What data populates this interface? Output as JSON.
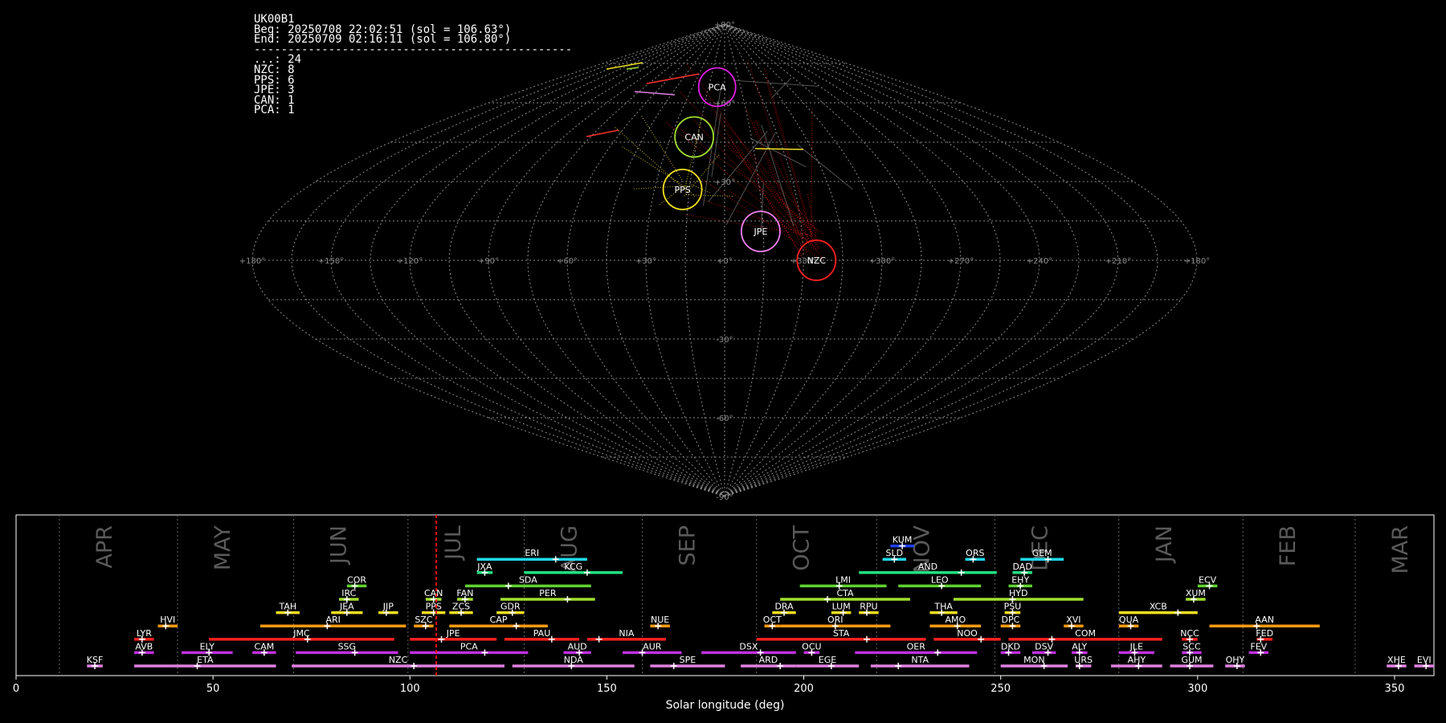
{
  "header": {
    "station": "UK00B1",
    "begin": "Beg: 20250708 22:02:51 (sol = 106.63°)",
    "end": "End: 20250709 02:16:11 (sol = 106.80°)",
    "separator": "-----------------------------------------------",
    "counts": [
      "...: 24",
      "NZC: 8",
      "PPS: 6",
      "JPE: 3",
      "CAN: 1",
      "PCA: 1"
    ]
  },
  "chart_data": [
    {
      "type": "scatter",
      "projection": "sinusoidal",
      "grid": true,
      "lon_labels": [
        "+180°",
        "+150°",
        "+120°",
        "+90°",
        "+60°",
        "+30°",
        "+0°",
        "+330°",
        "+300°",
        "+270°",
        "+240°",
        "+210°",
        "+180°"
      ],
      "lat_labels": [
        {
          "lat": 90,
          "text": "+90°"
        },
        {
          "lat": 60,
          "text": "+60°"
        },
        {
          "lat": 30,
          "text": "+30°"
        },
        {
          "lat": -30,
          "text": "-30°"
        },
        {
          "lat": -60,
          "text": "-60°"
        },
        {
          "lat": -90,
          "text": "-90°"
        }
      ],
      "radiants": [
        {
          "name": "PCA",
          "lon": 7,
          "lat": 66,
          "r": 23,
          "color": "#e020e0"
        },
        {
          "name": "CAN",
          "lon": 17,
          "lat": 47,
          "r": 24,
          "color": "#a0e030"
        },
        {
          "name": "PPS",
          "lon": 18,
          "lat": 27,
          "r": 24,
          "color": "#f0e020"
        },
        {
          "name": "JPE",
          "lon": 346,
          "lat": 11,
          "r": 24,
          "color": "#f080f0"
        },
        {
          "name": "NZC",
          "lon": 325,
          "lat": 0,
          "r": 24,
          "color": "#ff2020"
        }
      ]
    },
    {
      "type": "bar",
      "xlabel": "Solar longitude (deg)",
      "xlim": [
        0,
        360
      ],
      "ylim": [
        0,
        13.5
      ],
      "xticks": [
        0,
        50,
        100,
        150,
        200,
        250,
        300,
        350
      ],
      "current_sol": 106.7,
      "months": [
        {
          "name": "APR",
          "start": 11
        },
        {
          "name": "MAY",
          "start": 41
        },
        {
          "name": "JUN",
          "start": 70.5
        },
        {
          "name": "JUL",
          "start": 99.5
        },
        {
          "name": "AUG",
          "start": 129
        },
        {
          "name": "SEP",
          "start": 159
        },
        {
          "name": "OCT",
          "start": 188
        },
        {
          "name": "NOV",
          "start": 218.5
        },
        {
          "name": "DEC",
          "start": 248.5
        },
        {
          "name": "JAN",
          "start": 280
        },
        {
          "name": "FEB",
          "start": 311.5
        },
        {
          "name": "MAR",
          "start": 340
        }
      ],
      "showers": [
        {
          "code": "KSF",
          "start": 18,
          "end": 22,
          "peak": 20,
          "row": 0,
          "color": "#e080e0"
        },
        {
          "code": "ETA",
          "start": 30,
          "end": 66,
          "peak": 46,
          "row": 0,
          "color": "#e080e0"
        },
        {
          "code": "NZC",
          "start": 70,
          "end": 124,
          "peak": 101,
          "row": 0,
          "color": "#e080e0"
        },
        {
          "code": "NDA",
          "start": 126,
          "end": 157,
          "peak": 141,
          "row": 0,
          "color": "#e080e0"
        },
        {
          "code": "SPE",
          "start": 161,
          "end": 180,
          "peak": 167,
          "row": 0,
          "color": "#e080e0"
        },
        {
          "code": "ARD",
          "start": 184,
          "end": 198,
          "peak": 194,
          "row": 0,
          "color": "#e080e0"
        },
        {
          "code": "EGE",
          "start": 198,
          "end": 214,
          "peak": 207,
          "row": 0,
          "color": "#e080e0"
        },
        {
          "code": "NTA",
          "start": 217,
          "end": 242,
          "peak": 224,
          "row": 0,
          "color": "#e080e0"
        },
        {
          "code": "MON",
          "start": 250,
          "end": 267,
          "peak": 261,
          "row": 0,
          "color": "#e080e0"
        },
        {
          "code": "URS",
          "start": 269,
          "end": 273,
          "peak": 270,
          "row": 0,
          "color": "#e080e0"
        },
        {
          "code": "AHY",
          "start": 278,
          "end": 291,
          "peak": 285,
          "row": 0,
          "color": "#e080e0"
        },
        {
          "code": "GUM",
          "start": 293,
          "end": 304,
          "peak": 298,
          "row": 0,
          "color": "#e080e0"
        },
        {
          "code": "OHY",
          "start": 307,
          "end": 312,
          "peak": 310,
          "row": 0,
          "color": "#e080e0"
        },
        {
          "code": "XHE",
          "start": 348,
          "end": 353,
          "peak": 351,
          "row": 0,
          "color": "#e080e0"
        },
        {
          "code": "EVI",
          "start": 355,
          "end": 360,
          "peak": 358,
          "row": 0,
          "color": "#e080e0"
        },
        {
          "code": "AVB",
          "start": 30,
          "end": 35,
          "peak": 32,
          "row": 1,
          "color": "#c030e0"
        },
        {
          "code": "ELY",
          "start": 42,
          "end": 55,
          "peak": 49,
          "row": 1,
          "color": "#c030e0"
        },
        {
          "code": "CAM",
          "start": 60,
          "end": 66,
          "peak": 63,
          "row": 1,
          "color": "#c030e0"
        },
        {
          "code": "SSG",
          "start": 71,
          "end": 97,
          "peak": 86,
          "row": 1,
          "color": "#c030e0"
        },
        {
          "code": "PCA",
          "start": 100,
          "end": 130,
          "peak": 119,
          "row": 1,
          "color": "#c030e0"
        },
        {
          "code": "AUD",
          "start": 139,
          "end": 146,
          "peak": 143,
          "row": 1,
          "color": "#c030e0"
        },
        {
          "code": "AUR",
          "start": 154,
          "end": 169,
          "peak": 159,
          "row": 1,
          "color": "#c030e0"
        },
        {
          "code": "DSX",
          "start": 174,
          "end": 198,
          "peak": 189,
          "row": 1,
          "color": "#c030e0"
        },
        {
          "code": "OCU",
          "start": 200,
          "end": 204,
          "peak": 202,
          "row": 1,
          "color": "#c030e0"
        },
        {
          "code": "OER",
          "start": 213,
          "end": 244,
          "peak": 234,
          "row": 1,
          "color": "#c030e0"
        },
        {
          "code": "DKD",
          "start": 250,
          "end": 255,
          "peak": 252,
          "row": 1,
          "color": "#c030e0"
        },
        {
          "code": "DSV",
          "start": 258,
          "end": 264,
          "peak": 262,
          "row": 1,
          "color": "#c030e0"
        },
        {
          "code": "ALY",
          "start": 268,
          "end": 272,
          "peak": 270,
          "row": 1,
          "color": "#c030e0"
        },
        {
          "code": "JLE",
          "start": 280,
          "end": 289,
          "peak": 284,
          "row": 1,
          "color": "#c030e0"
        },
        {
          "code": "SCC",
          "start": 296,
          "end": 301,
          "peak": 298,
          "row": 1,
          "color": "#c030e0"
        },
        {
          "code": "FEV",
          "start": 313,
          "end": 318,
          "peak": 316,
          "row": 1,
          "color": "#c030e0"
        },
        {
          "code": "LYR",
          "start": 30,
          "end": 35,
          "peak": 32,
          "row": 2,
          "color": "#ff2020"
        },
        {
          "code": "JMC",
          "start": 49,
          "end": 96,
          "peak": 74,
          "row": 2,
          "color": "#ff2020"
        },
        {
          "code": "JPE",
          "start": 100,
          "end": 122,
          "peak": 108,
          "row": 2,
          "color": "#ff2020"
        },
        {
          "code": "PAU",
          "start": 124,
          "end": 143,
          "peak": 136,
          "row": 2,
          "color": "#ff2020"
        },
        {
          "code": "NIA",
          "start": 145,
          "end": 165,
          "peak": 148,
          "row": 2,
          "color": "#ff2020"
        },
        {
          "code": "STA",
          "start": 188,
          "end": 231,
          "peak": 216,
          "row": 2,
          "color": "#ff2020"
        },
        {
          "code": "NOO",
          "start": 233,
          "end": 250,
          "peak": 245,
          "row": 2,
          "color": "#ff2020"
        },
        {
          "code": "COM",
          "start": 252,
          "end": 291,
          "peak": 263,
          "row": 2,
          "color": "#ff2020"
        },
        {
          "code": "NCC",
          "start": 296,
          "end": 300,
          "peak": 298,
          "row": 2,
          "color": "#ff2020"
        },
        {
          "code": "FED",
          "start": 315,
          "end": 319,
          "peak": 316,
          "row": 2,
          "color": "#ff2020"
        },
        {
          "code": "HVI",
          "start": 36,
          "end": 41,
          "peak": 38,
          "row": 3,
          "color": "#ff9a10"
        },
        {
          "code": "ARI",
          "start": 62,
          "end": 99,
          "peak": 79,
          "row": 3,
          "color": "#ff9a10"
        },
        {
          "code": "SZC",
          "start": 101,
          "end": 106,
          "peak": 104,
          "row": 3,
          "color": "#ff9a10"
        },
        {
          "code": "CAP",
          "start": 110,
          "end": 135,
          "peak": 127,
          "row": 3,
          "color": "#ff9a10"
        },
        {
          "code": "NUE",
          "start": 161,
          "end": 166,
          "peak": 163,
          "row": 3,
          "color": "#ff9a10"
        },
        {
          "code": "OCT",
          "start": 190,
          "end": 194,
          "peak": 192,
          "row": 3,
          "color": "#ff9a10"
        },
        {
          "code": "ORI",
          "start": 194,
          "end": 222,
          "peak": 208,
          "row": 3,
          "color": "#ff9a10"
        },
        {
          "code": "AMO",
          "start": 232,
          "end": 245,
          "peak": 239,
          "row": 3,
          "color": "#ff9a10"
        },
        {
          "code": "DPC",
          "start": 250,
          "end": 255,
          "peak": 253,
          "row": 3,
          "color": "#ff9a10"
        },
        {
          "code": "XVI",
          "start": 266,
          "end": 271,
          "peak": 268,
          "row": 3,
          "color": "#ff9a10"
        },
        {
          "code": "QUA",
          "start": 280,
          "end": 285,
          "peak": 283,
          "row": 3,
          "color": "#ff9a10"
        },
        {
          "code": "AAN",
          "start": 303,
          "end": 331,
          "peak": 315,
          "row": 3,
          "color": "#ff9a10"
        },
        {
          "code": "TAH",
          "start": 66,
          "end": 72,
          "peak": 69,
          "row": 4,
          "color": "#f0e020"
        },
        {
          "code": "JEA",
          "start": 80,
          "end": 88,
          "peak": 84,
          "row": 4,
          "color": "#f0e020"
        },
        {
          "code": "JIP",
          "start": 92,
          "end": 97,
          "peak": 94,
          "row": 4,
          "color": "#f0e020"
        },
        {
          "code": "PPS",
          "start": 103,
          "end": 109,
          "peak": 106,
          "row": 4,
          "color": "#f0e020"
        },
        {
          "code": "ZCS",
          "start": 110,
          "end": 116,
          "peak": 113,
          "row": 4,
          "color": "#f0e020"
        },
        {
          "code": "GDR",
          "start": 122,
          "end": 129,
          "peak": 126,
          "row": 4,
          "color": "#f0e020"
        },
        {
          "code": "DRA",
          "start": 192,
          "end": 198,
          "peak": 195,
          "row": 4,
          "color": "#f0e020"
        },
        {
          "code": "LUM",
          "start": 207,
          "end": 212,
          "peak": 210,
          "row": 4,
          "color": "#f0e020"
        },
        {
          "code": "RPU",
          "start": 214,
          "end": 219,
          "peak": 216,
          "row": 4,
          "color": "#f0e020"
        },
        {
          "code": "THA",
          "start": 232,
          "end": 239,
          "peak": 235,
          "row": 4,
          "color": "#f0e020"
        },
        {
          "code": "PSU",
          "start": 251,
          "end": 255,
          "peak": 253,
          "row": 4,
          "color": "#f0e020"
        },
        {
          "code": "XCB",
          "start": 280,
          "end": 300,
          "peak": 295,
          "row": 4,
          "color": "#f0e020"
        },
        {
          "code": "IRC",
          "start": 82,
          "end": 87,
          "peak": 84,
          "row": 5,
          "color": "#a0e030"
        },
        {
          "code": "CAN",
          "start": 104,
          "end": 108,
          "peak": 106,
          "row": 5,
          "color": "#a0e030"
        },
        {
          "code": "FAN",
          "start": 112,
          "end": 116,
          "peak": 114,
          "row": 5,
          "color": "#a0e030"
        },
        {
          "code": "PER",
          "start": 123,
          "end": 147,
          "peak": 140,
          "row": 5,
          "color": "#a0e030"
        },
        {
          "code": "CTA",
          "start": 194,
          "end": 227,
          "peak": 206,
          "row": 5,
          "color": "#a0e030"
        },
        {
          "code": "HYD",
          "start": 238,
          "end": 271,
          "peak": 253,
          "row": 5,
          "color": "#a0e030"
        },
        {
          "code": "XUM",
          "start": 297,
          "end": 302,
          "peak": 299,
          "row": 5,
          "color": "#a0e030"
        },
        {
          "code": "COR",
          "start": 84,
          "end": 89,
          "peak": 86,
          "row": 6,
          "color": "#60d030"
        },
        {
          "code": "SDA",
          "start": 114,
          "end": 146,
          "peak": 125,
          "row": 6,
          "color": "#60d030"
        },
        {
          "code": "LMI",
          "start": 199,
          "end": 221,
          "peak": 209,
          "row": 6,
          "color": "#60d030"
        },
        {
          "code": "LEO",
          "start": 224,
          "end": 245,
          "peak": 235,
          "row": 6,
          "color": "#60d030"
        },
        {
          "code": "EHY",
          "start": 252,
          "end": 258,
          "peak": 255,
          "row": 6,
          "color": "#60d030"
        },
        {
          "code": "ECV",
          "start": 300,
          "end": 305,
          "peak": 303,
          "row": 6,
          "color": "#60d030"
        },
        {
          "code": "JXA",
          "start": 117,
          "end": 121,
          "peak": 119,
          "row": 7,
          "color": "#20e080"
        },
        {
          "code": "KCG",
          "start": 129,
          "end": 154,
          "peak": 145,
          "row": 7,
          "color": "#20e080"
        },
        {
          "code": "AND",
          "start": 214,
          "end": 249,
          "peak": 240,
          "row": 7,
          "color": "#20e080"
        },
        {
          "code": "DAD",
          "start": 253,
          "end": 258,
          "peak": 256,
          "row": 7,
          "color": "#20e080"
        },
        {
          "code": "ERI",
          "start": 117,
          "end": 145,
          "peak": 137,
          "row": 8,
          "color": "#20d8e8"
        },
        {
          "code": "SLD",
          "start": 220,
          "end": 226,
          "peak": 223,
          "row": 8,
          "color": "#20d8e8"
        },
        {
          "code": "ORS",
          "start": 241,
          "end": 246,
          "peak": 243,
          "row": 8,
          "color": "#20d8e8"
        },
        {
          "code": "GEM",
          "start": 255,
          "end": 266,
          "peak": 262,
          "row": 8,
          "color": "#20d8e8"
        },
        {
          "code": "KUM",
          "start": 222,
          "end": 228,
          "peak": 225,
          "row": 9,
          "color": "#2040ff"
        }
      ]
    }
  ]
}
